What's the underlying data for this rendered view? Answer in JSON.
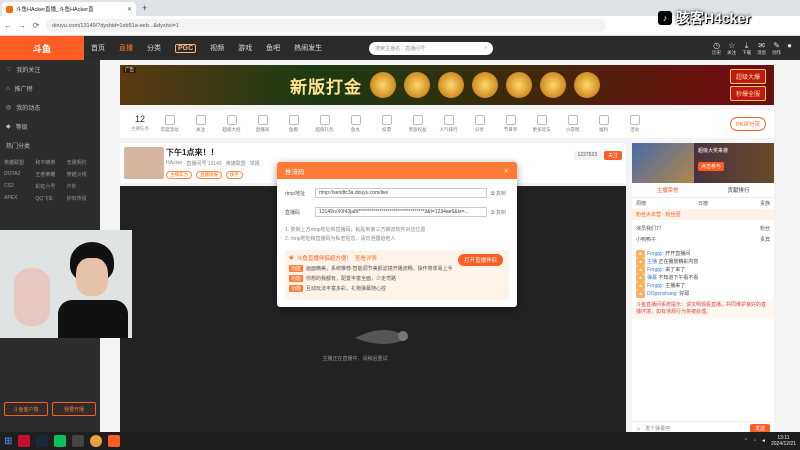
{
  "browser": {
    "tab_title": "斗鱼HAcker直播_斗鱼HAcker直",
    "url": "douyu.com/13149/?dyshid=1eb51a-eeb...&dyshci=1"
  },
  "header": {
    "logo": "斗鱼",
    "nav": [
      "首页",
      "直播",
      "分类",
      "PGC",
      "视频",
      "游戏",
      "鱼吧",
      "热闹发生"
    ],
    "pgc_sub": "PGC\n点击查看所有",
    "search_placeholder": "搜索主播名、直播间号",
    "icons": [
      {
        "label": "历史",
        "icon": "history-icon"
      },
      {
        "label": "关注",
        "icon": "star-icon"
      },
      {
        "label": "下载",
        "icon": "download-icon"
      },
      {
        "label": "消息",
        "icon": "message-icon"
      },
      {
        "label": "创作",
        "icon": "create-icon"
      }
    ]
  },
  "sidebar": {
    "items": [
      "我的关注",
      "推广榜",
      "我的动态",
      "等级"
    ],
    "categories_title": "热门分类",
    "categories": [
      "英雄联盟",
      "和平精英",
      "无畏契约",
      "DOTA2",
      "王者荣耀",
      "穿越火线",
      "CS2",
      "彩虹六号",
      "户外",
      "APEX",
      "QQ飞车",
      "炉石传说"
    ],
    "footer_buttons": [
      "斗鱼客户端",
      "我要开播"
    ]
  },
  "banner": {
    "ad_tag": "广告",
    "slogan": "新版打金",
    "cta": [
      "超级大爆",
      "秒爆全服"
    ]
  },
  "gift_strip": {
    "count": "12",
    "count_label": "主播任务",
    "items": [
      "年度活动",
      "关注",
      "超级大招",
      "直播间",
      "鱼粮",
      "超值礼包",
      "鱼丸",
      "投票",
      "贵族权益",
      "人气排行",
      "分享",
      "节目单",
      "更多玩法",
      "小游戏",
      "福利",
      "活动"
    ],
    "pk_label": "PK评分流"
  },
  "stream": {
    "title": "下午1点来！！",
    "meta": [
      "HAcker",
      "直播间号 13149",
      "英雄联盟",
      "举报"
    ],
    "tags": [
      "主播实力",
      "直播周报",
      "快手"
    ],
    "hot": "1227523",
    "follow": "关注"
  },
  "modal": {
    "title": "推流码",
    "rtmp_label": "rtmp地址",
    "rtmp_value": "rtmp://sendtc3a.douyu.com/live",
    "key_label": "直播码",
    "key_value": "13149rvX0f43ja8t**********************************3&t=1234ae6&tx=...",
    "copy": "复制",
    "tips": [
      "1. 复制上方rtmp地址和直播码，粘贴到第三方推流软件对应位置",
      "2. rtmp地址和直播码为私密信息，请勿泄露给他人"
    ],
    "promo_title": "斗鱼直播伴侣超方便！",
    "promo_link": "查看详情",
    "promo_button": "打开直播伴侣",
    "features": [
      {
        "badge": "功能",
        "text": "画面精美，系统推荐·智能调节美颜滤镜开播流畅，操作简单易上手"
      },
      {
        "badge": "功能",
        "text": "你想的我都有，配置丰富全面，少走弯路"
      },
      {
        "badge": "功能",
        "text": "互动玩法丰富多彩，礼物弹幕随心控"
      }
    ]
  },
  "player": {
    "loading_text": "主播正在直播中，请稍后重试"
  },
  "right_panel": {
    "promo_text": "超级大奖来袭",
    "promo_action": "点击参与",
    "tabs": [
      "主播荣誉",
      "贡献排行"
    ],
    "row": [
      "周榜",
      "日榜",
      "贵族"
    ],
    "fan_label": "粉丝团",
    "rank_title": "粉丝大本营",
    "rank": [
      {
        "name": "演员我们77",
        "value": "粉丝"
      },
      {
        "name": "小鸭鸭子",
        "value": "贵宾"
      }
    ],
    "chat": [
      {
        "user": "Froggy:",
        "text": "开开直播间"
      },
      {
        "user": "主播",
        "text": "正在播放精彩内容"
      },
      {
        "user": "Froggy:",
        "text": "来了来了"
      },
      {
        "user": "弹幕",
        "text": "不知道下午看不看"
      },
      {
        "user": "Froggy:",
        "text": "主播来了"
      },
      {
        "user": "DOpenshang:",
        "text": "好耶"
      }
    ],
    "notice": "斗鱼直播间系统提示：请文明观看直播，共同维护良好的直播环境，如有违规行为将被处理。",
    "input_placeholder": "发个弹幕吧",
    "send": "发送"
  },
  "watermark": "骇客H4cker",
  "taskbar": {
    "time": "13:11",
    "date": "2024/12/21"
  }
}
